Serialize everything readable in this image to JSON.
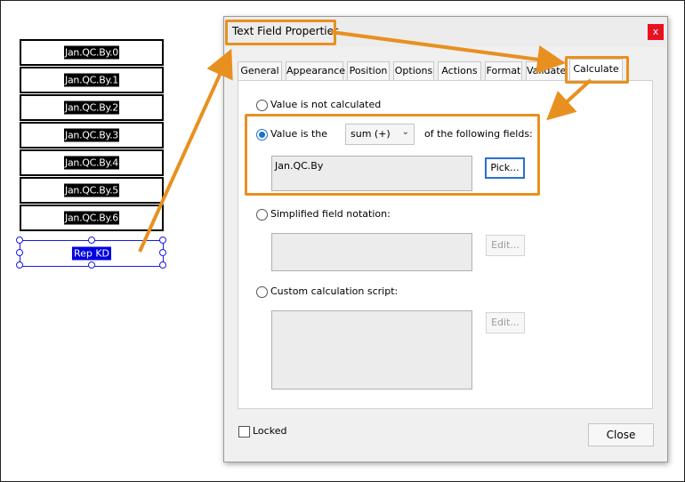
{
  "form_fields": [
    {
      "label": "Jan.QC.By.0"
    },
    {
      "label": "Jan.QC.By.1"
    },
    {
      "label": "Jan.QC.By.2"
    },
    {
      "label": "Jan.QC.By.3"
    },
    {
      "label": "Jan.QC.By.4"
    },
    {
      "label": "Jan.QC.By.5"
    },
    {
      "label": "Jan.QC.By.6"
    }
  ],
  "selected_field": {
    "label": "Rep KD"
  },
  "dialog": {
    "title": "Text Field Properties",
    "close_glyph": "x",
    "tabs": [
      "General",
      "Appearance",
      "Position",
      "Options",
      "Actions",
      "Format",
      "Validate",
      "Calculate"
    ],
    "active_tab": "Calculate",
    "option_not_calculated": "Value is not calculated",
    "option_value_is": "Value is the",
    "operation_select": "sum (+)",
    "of_following_fields": "of the following fields:",
    "fields_value": "Jan.QC.By",
    "pick_button": "Pick...",
    "option_simplified": "Simplified field notation:",
    "edit_button": "Edit...",
    "option_custom": "Custom calculation script:",
    "locked_label": "Locked",
    "close_button": "Close"
  },
  "annotation_color": "#e8901f",
  "icons": {
    "select_chevron": "chevron-down-icon",
    "close": "close-icon"
  }
}
